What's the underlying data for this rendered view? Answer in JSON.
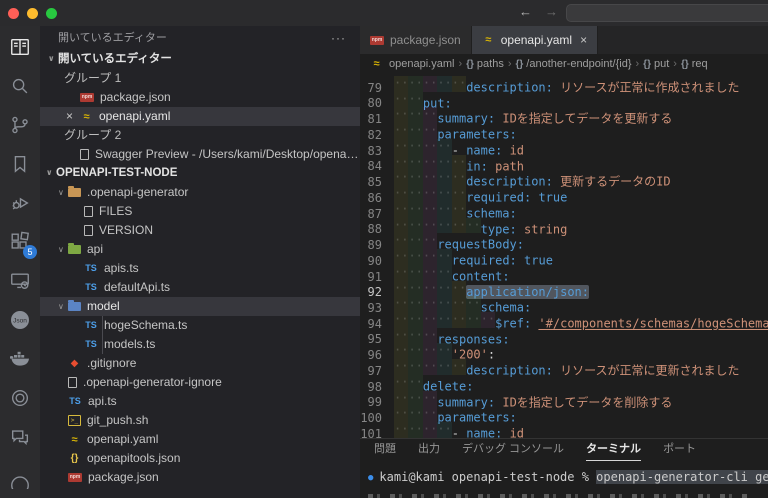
{
  "window": {
    "traffic_lights": [
      "#ff5f57",
      "#febc2e",
      "#28c840"
    ]
  },
  "titlebar": {
    "back_icon": "←",
    "forward_icon": "→"
  },
  "activity_bar": {
    "items": [
      {
        "name": "explorer-book",
        "active": true
      },
      {
        "name": "search",
        "active": false
      },
      {
        "name": "source-control",
        "active": false
      },
      {
        "name": "bookmarks",
        "active": false
      },
      {
        "name": "run-debug",
        "active": false
      },
      {
        "name": "extensions",
        "active": false,
        "badge": "5"
      },
      {
        "name": "remote-explorer",
        "active": false
      },
      {
        "name": "json-tool",
        "active": false,
        "label": "Json"
      },
      {
        "name": "docker",
        "active": false
      },
      {
        "name": "ring-tool",
        "active": false
      },
      {
        "name": "chat",
        "active": false
      }
    ],
    "extensions_badge": "5"
  },
  "sidebar": {
    "panel_title": "開いているエディター",
    "menu_icon": "···",
    "open_editors_section": "開いているエディター",
    "groups": [
      {
        "label": "グループ 1",
        "files": [
          {
            "label": "package.json",
            "icon": "npm",
            "active": false
          },
          {
            "label": "openapi.yaml",
            "icon": "yaml",
            "active": true,
            "close_icon": "×"
          }
        ]
      },
      {
        "label": "グループ 2",
        "files": [
          {
            "label": "Swagger Preview - /Users/kami/Desktop/openap...",
            "icon": "doc",
            "active": false
          }
        ]
      }
    ],
    "project_root": "OPENAPI-TEST-NODE",
    "tree": [
      {
        "kind": "folder",
        "icon": "folder",
        "label": ".openapi-generator",
        "level": 1
      },
      {
        "kind": "file",
        "icon": "doc",
        "label": "FILES",
        "level": 2
      },
      {
        "kind": "file",
        "icon": "doc",
        "label": "VERSION",
        "level": 2
      },
      {
        "kind": "folder",
        "icon": "folder-api",
        "label": "api",
        "level": 1
      },
      {
        "kind": "file",
        "icon": "ts",
        "label": "apis.ts",
        "level": 2
      },
      {
        "kind": "file",
        "icon": "ts",
        "label": "defaultApi.ts",
        "level": 2
      },
      {
        "kind": "folder",
        "icon": "folder-model",
        "label": "model",
        "level": 1,
        "selected": true
      },
      {
        "kind": "file",
        "icon": "ts",
        "label": "hogeSchema.ts",
        "level": 2,
        "guide": true
      },
      {
        "kind": "file",
        "icon": "ts",
        "label": "models.ts",
        "level": 2,
        "guide": true
      },
      {
        "kind": "file",
        "icon": "git",
        "label": ".gitignore",
        "level": 1
      },
      {
        "kind": "file",
        "icon": "doc",
        "label": ".openapi-generator-ignore",
        "level": 1
      },
      {
        "kind": "file",
        "icon": "ts",
        "label": "api.ts",
        "level": 1
      },
      {
        "kind": "file",
        "icon": "sh",
        "label": "git_push.sh",
        "level": 1
      },
      {
        "kind": "file",
        "icon": "yaml",
        "label": "openapi.yaml",
        "level": 1
      },
      {
        "kind": "file",
        "icon": "braces",
        "label": "openapitools.json",
        "level": 1
      },
      {
        "kind": "file",
        "icon": "npm",
        "label": "package.json",
        "level": 1
      }
    ]
  },
  "editor": {
    "tabs": [
      {
        "label": "package.json",
        "icon": "npm",
        "active": false
      },
      {
        "label": "openapi.yaml",
        "icon": "yaml",
        "active": true,
        "close_icon": "×"
      }
    ],
    "breadcrumb": [
      {
        "icon": "yaml",
        "label": "openapi.yaml"
      },
      {
        "icon": "braces",
        "label": "paths"
      },
      {
        "icon": "braces",
        "label": "/another-endpoint/{id}"
      },
      {
        "icon": "braces",
        "label": "put"
      },
      {
        "icon": "braces",
        "label": "req"
      }
    ],
    "code_lines": [
      {
        "n": 79,
        "ind": 10,
        "toks": [
          [
            "k",
            "description:"
          ],
          [
            "p",
            " "
          ],
          [
            "v",
            "リソースが正常に作成されました"
          ]
        ]
      },
      {
        "n": 80,
        "ind": 4,
        "toks": [
          [
            "k",
            "put:"
          ]
        ]
      },
      {
        "n": 81,
        "ind": 6,
        "toks": [
          [
            "k",
            "summary:"
          ],
          [
            "p",
            " "
          ],
          [
            "v",
            "IDを指定してデータを更新する"
          ]
        ]
      },
      {
        "n": 82,
        "ind": 6,
        "toks": [
          [
            "k",
            "parameters:"
          ]
        ]
      },
      {
        "n": 83,
        "ind": 8,
        "toks": [
          [
            "p",
            "- "
          ],
          [
            "k",
            "name:"
          ],
          [
            "p",
            " "
          ],
          [
            "v",
            "id"
          ]
        ]
      },
      {
        "n": 84,
        "ind": 10,
        "toks": [
          [
            "k",
            "in:"
          ],
          [
            "p",
            " "
          ],
          [
            "v",
            "path"
          ]
        ]
      },
      {
        "n": 85,
        "ind": 10,
        "toks": [
          [
            "k",
            "description:"
          ],
          [
            "p",
            " "
          ],
          [
            "v",
            "更新するデータのID"
          ]
        ]
      },
      {
        "n": 86,
        "ind": 10,
        "toks": [
          [
            "k",
            "required:"
          ],
          [
            "p",
            " "
          ],
          [
            "b",
            "true"
          ]
        ]
      },
      {
        "n": 87,
        "ind": 10,
        "toks": [
          [
            "k",
            "schema:"
          ]
        ]
      },
      {
        "n": 88,
        "ind": 12,
        "toks": [
          [
            "k",
            "type:"
          ],
          [
            "p",
            " "
          ],
          [
            "v",
            "string"
          ]
        ]
      },
      {
        "n": 89,
        "ind": 6,
        "toks": [
          [
            "k",
            "requestBody:"
          ]
        ]
      },
      {
        "n": 90,
        "ind": 8,
        "toks": [
          [
            "k",
            "required:"
          ],
          [
            "p",
            " "
          ],
          [
            "b",
            "true"
          ]
        ]
      },
      {
        "n": 91,
        "ind": 8,
        "toks": [
          [
            "k",
            "content:"
          ]
        ]
      },
      {
        "n": 92,
        "ind": 10,
        "toks": [
          [
            "k hl",
            "application/json:"
          ]
        ],
        "current": true
      },
      {
        "n": 93,
        "ind": 12,
        "toks": [
          [
            "k",
            "schema:"
          ]
        ]
      },
      {
        "n": 94,
        "ind": 14,
        "toks": [
          [
            "k",
            "$ref:"
          ],
          [
            "p",
            " "
          ],
          [
            "link",
            "'#/components/schemas/hogeSchema'"
          ]
        ]
      },
      {
        "n": 95,
        "ind": 6,
        "toks": [
          [
            "k",
            "responses:"
          ]
        ]
      },
      {
        "n": 96,
        "ind": 8,
        "toks": [
          [
            "v",
            "'200'"
          ],
          [
            "p",
            ":"
          ]
        ]
      },
      {
        "n": 97,
        "ind": 10,
        "toks": [
          [
            "k",
            "description:"
          ],
          [
            "p",
            " "
          ],
          [
            "v",
            "リソースが正常に更新されました"
          ]
        ]
      },
      {
        "n": 98,
        "ind": 4,
        "toks": [
          [
            "k",
            "delete:"
          ]
        ]
      },
      {
        "n": 99,
        "ind": 6,
        "toks": [
          [
            "k",
            "summary:"
          ],
          [
            "p",
            " "
          ],
          [
            "v",
            "IDを指定してデータを削除する"
          ]
        ]
      },
      {
        "n": 100,
        "ind": 6,
        "toks": [
          [
            "k",
            "parameters:"
          ]
        ]
      },
      {
        "n": 101,
        "ind": 8,
        "toks": [
          [
            "p",
            "- "
          ],
          [
            "k",
            "name:"
          ],
          [
            "p",
            " "
          ],
          [
            "v",
            "id"
          ]
        ]
      }
    ]
  },
  "panel": {
    "tabs": [
      {
        "label": "問題",
        "active": false
      },
      {
        "label": "出力",
        "active": false
      },
      {
        "label": "デバッグ コンソール",
        "active": false
      },
      {
        "label": "ターミナル",
        "active": true
      },
      {
        "label": "ポート",
        "active": false
      }
    ],
    "terminal": {
      "decoration": "●",
      "prompt": "kami@kami openapi-test-node % ",
      "command": "openapi-generator-cli generate -i ~/D"
    }
  },
  "colors": {
    "yaml_key": "#569cd6",
    "yaml_value": "#ce9178",
    "editor_bg": "#1e1e1e",
    "sidebar_bg": "#232327",
    "selection_row": "#37373d",
    "badge": "#2f7bd6",
    "terminal_decoration": "#3b8eea"
  }
}
